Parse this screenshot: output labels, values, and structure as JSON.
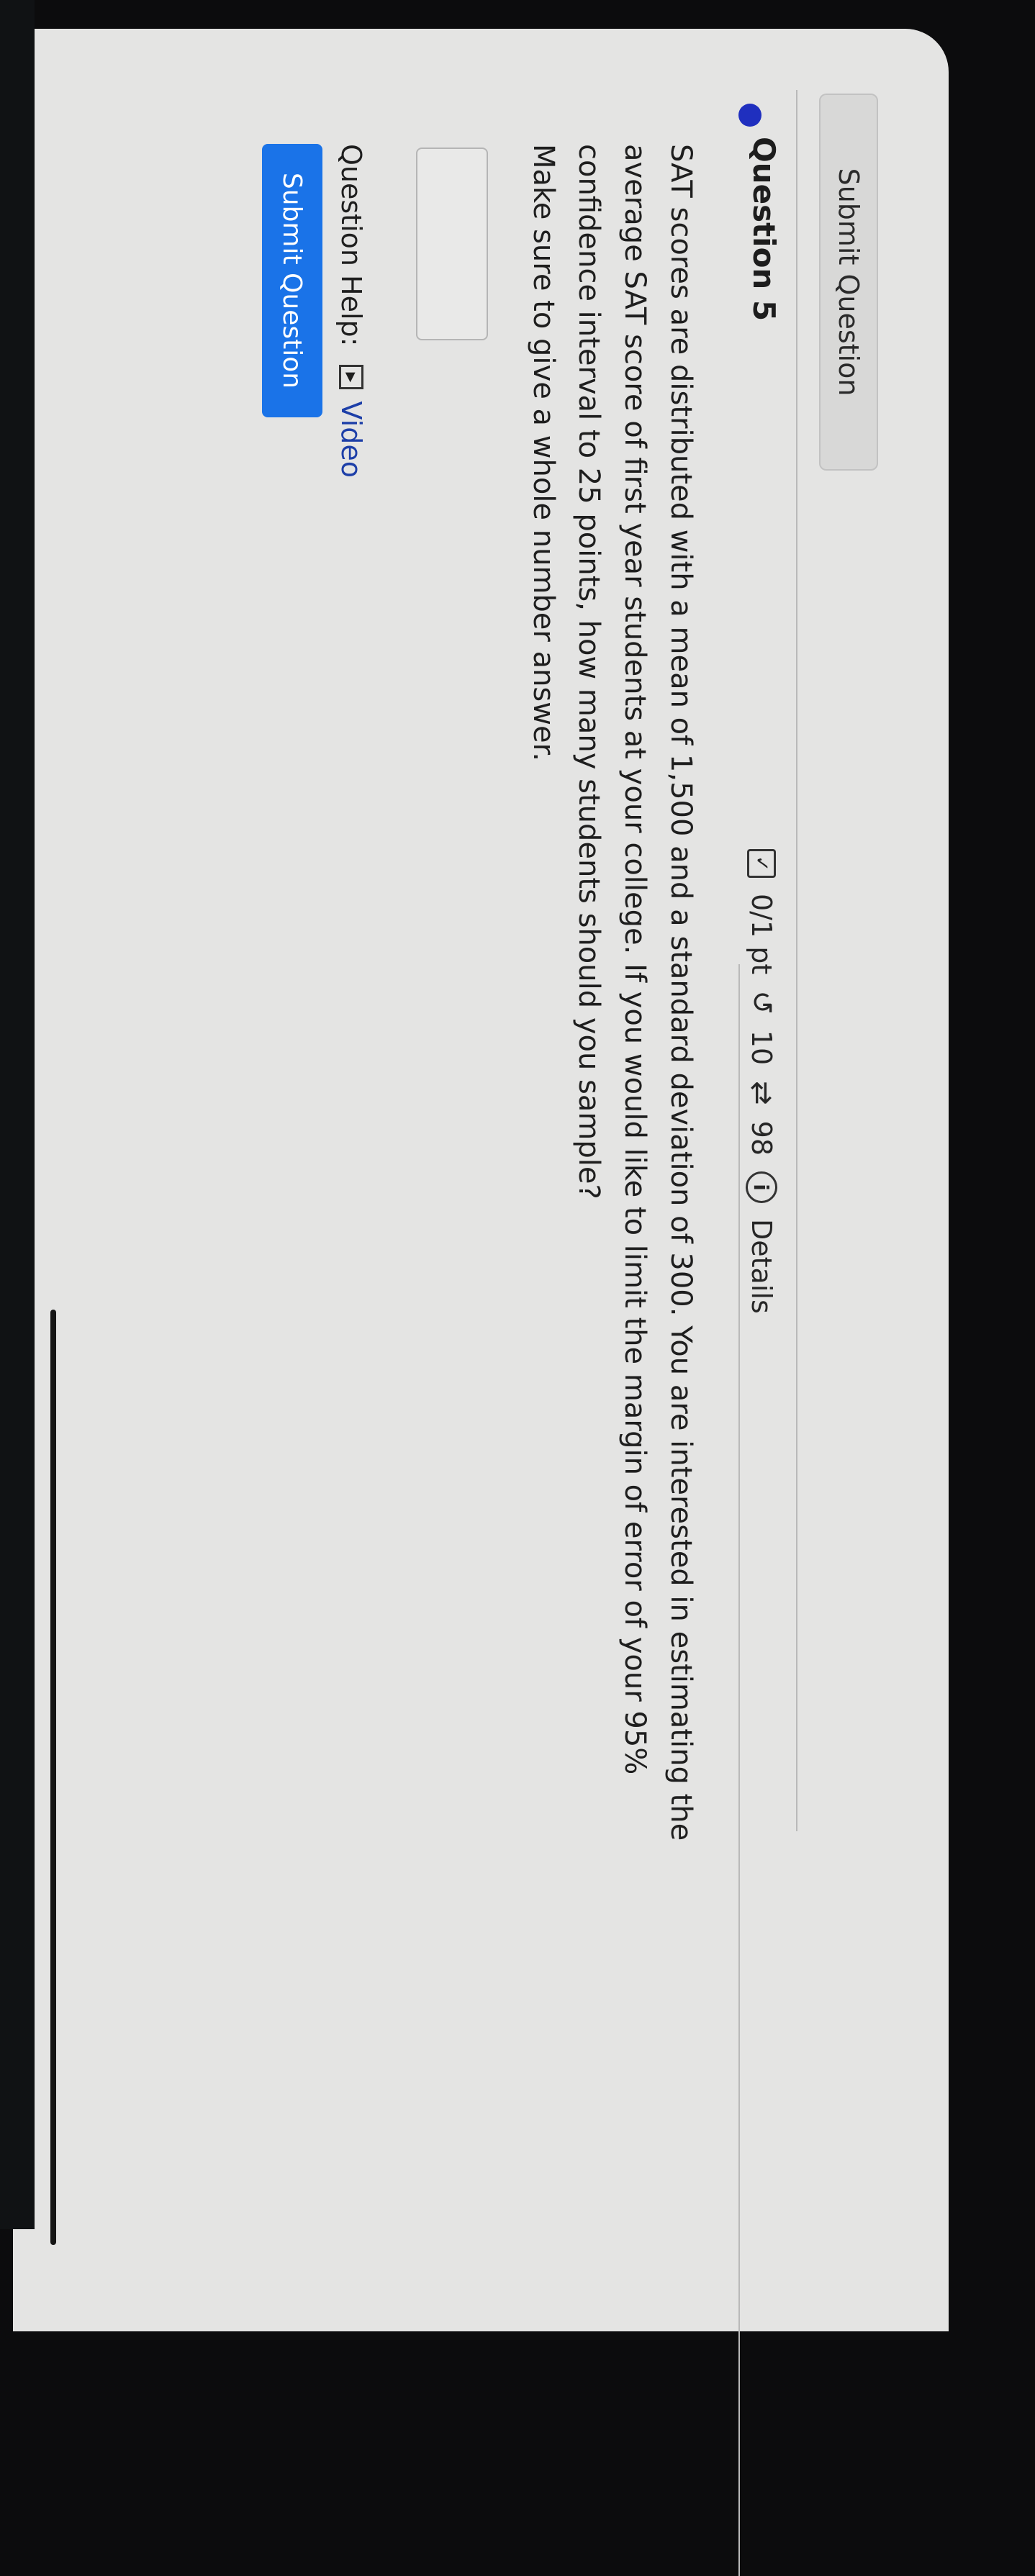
{
  "top": {
    "submit_label": "Submit Question"
  },
  "question": {
    "title": "Question 5",
    "score": "0/1 pt",
    "retries": "10",
    "attempts": "98",
    "details_label": "Details",
    "text": "SAT scores are distributed with a mean of 1,500 and a standard deviation of 300. You are interested in estimating the average SAT score of first year students at your college. If you would like to limit the margin of error of your 95% confidence interval to 25 points, how many students should you sample?",
    "instruction": "Make sure to give a whole number answer.",
    "answer_value": ""
  },
  "help": {
    "label": "Question Help:",
    "video_label": "Video"
  },
  "bottom": {
    "submit_label": "Submit Question"
  },
  "icons": {
    "score": "checkbox-icon",
    "retry": "undo-icon",
    "attempts": "repeat-icon",
    "details": "info-icon",
    "video": "play-icon"
  },
  "colors": {
    "accent": "#1a73e8",
    "link": "#1d3fa8",
    "status_dot": "#1f2fbf"
  }
}
